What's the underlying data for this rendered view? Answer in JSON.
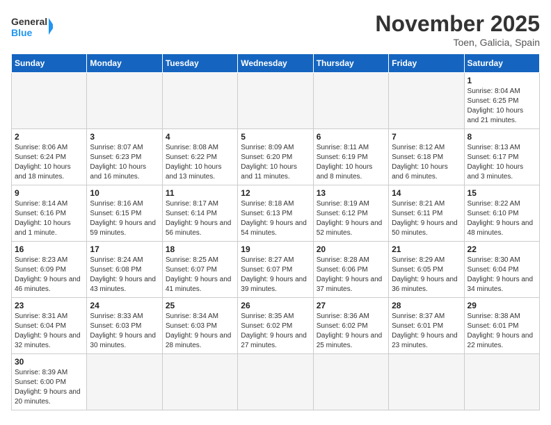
{
  "header": {
    "logo_general": "General",
    "logo_blue": "Blue",
    "month_title": "November 2025",
    "location": "Toen, Galicia, Spain"
  },
  "weekdays": [
    "Sunday",
    "Monday",
    "Tuesday",
    "Wednesday",
    "Thursday",
    "Friday",
    "Saturday"
  ],
  "weeks": [
    [
      {
        "day": "",
        "info": "",
        "empty": true
      },
      {
        "day": "",
        "info": "",
        "empty": true
      },
      {
        "day": "",
        "info": "",
        "empty": true
      },
      {
        "day": "",
        "info": "",
        "empty": true
      },
      {
        "day": "",
        "info": "",
        "empty": true
      },
      {
        "day": "",
        "info": "",
        "empty": true
      },
      {
        "day": "1",
        "info": "Sunrise: 8:04 AM\nSunset: 6:25 PM\nDaylight: 10 hours\nand 21 minutes."
      }
    ],
    [
      {
        "day": "2",
        "info": "Sunrise: 8:06 AM\nSunset: 6:24 PM\nDaylight: 10 hours\nand 18 minutes."
      },
      {
        "day": "3",
        "info": "Sunrise: 8:07 AM\nSunset: 6:23 PM\nDaylight: 10 hours\nand 16 minutes."
      },
      {
        "day": "4",
        "info": "Sunrise: 8:08 AM\nSunset: 6:22 PM\nDaylight: 10 hours\nand 13 minutes."
      },
      {
        "day": "5",
        "info": "Sunrise: 8:09 AM\nSunset: 6:20 PM\nDaylight: 10 hours\nand 11 minutes."
      },
      {
        "day": "6",
        "info": "Sunrise: 8:11 AM\nSunset: 6:19 PM\nDaylight: 10 hours\nand 8 minutes."
      },
      {
        "day": "7",
        "info": "Sunrise: 8:12 AM\nSunset: 6:18 PM\nDaylight: 10 hours\nand 6 minutes."
      },
      {
        "day": "8",
        "info": "Sunrise: 8:13 AM\nSunset: 6:17 PM\nDaylight: 10 hours\nand 3 minutes."
      }
    ],
    [
      {
        "day": "9",
        "info": "Sunrise: 8:14 AM\nSunset: 6:16 PM\nDaylight: 10 hours\nand 1 minute."
      },
      {
        "day": "10",
        "info": "Sunrise: 8:16 AM\nSunset: 6:15 PM\nDaylight: 9 hours\nand 59 minutes."
      },
      {
        "day": "11",
        "info": "Sunrise: 8:17 AM\nSunset: 6:14 PM\nDaylight: 9 hours\nand 56 minutes."
      },
      {
        "day": "12",
        "info": "Sunrise: 8:18 AM\nSunset: 6:13 PM\nDaylight: 9 hours\nand 54 minutes."
      },
      {
        "day": "13",
        "info": "Sunrise: 8:19 AM\nSunset: 6:12 PM\nDaylight: 9 hours\nand 52 minutes."
      },
      {
        "day": "14",
        "info": "Sunrise: 8:21 AM\nSunset: 6:11 PM\nDaylight: 9 hours\nand 50 minutes."
      },
      {
        "day": "15",
        "info": "Sunrise: 8:22 AM\nSunset: 6:10 PM\nDaylight: 9 hours\nand 48 minutes."
      }
    ],
    [
      {
        "day": "16",
        "info": "Sunrise: 8:23 AM\nSunset: 6:09 PM\nDaylight: 9 hours\nand 46 minutes."
      },
      {
        "day": "17",
        "info": "Sunrise: 8:24 AM\nSunset: 6:08 PM\nDaylight: 9 hours\nand 43 minutes."
      },
      {
        "day": "18",
        "info": "Sunrise: 8:25 AM\nSunset: 6:07 PM\nDaylight: 9 hours\nand 41 minutes."
      },
      {
        "day": "19",
        "info": "Sunrise: 8:27 AM\nSunset: 6:07 PM\nDaylight: 9 hours\nand 39 minutes."
      },
      {
        "day": "20",
        "info": "Sunrise: 8:28 AM\nSunset: 6:06 PM\nDaylight: 9 hours\nand 37 minutes."
      },
      {
        "day": "21",
        "info": "Sunrise: 8:29 AM\nSunset: 6:05 PM\nDaylight: 9 hours\nand 36 minutes."
      },
      {
        "day": "22",
        "info": "Sunrise: 8:30 AM\nSunset: 6:04 PM\nDaylight: 9 hours\nand 34 minutes."
      }
    ],
    [
      {
        "day": "23",
        "info": "Sunrise: 8:31 AM\nSunset: 6:04 PM\nDaylight: 9 hours\nand 32 minutes."
      },
      {
        "day": "24",
        "info": "Sunrise: 8:33 AM\nSunset: 6:03 PM\nDaylight: 9 hours\nand 30 minutes."
      },
      {
        "day": "25",
        "info": "Sunrise: 8:34 AM\nSunset: 6:03 PM\nDaylight: 9 hours\nand 28 minutes."
      },
      {
        "day": "26",
        "info": "Sunrise: 8:35 AM\nSunset: 6:02 PM\nDaylight: 9 hours\nand 27 minutes."
      },
      {
        "day": "27",
        "info": "Sunrise: 8:36 AM\nSunset: 6:02 PM\nDaylight: 9 hours\nand 25 minutes."
      },
      {
        "day": "28",
        "info": "Sunrise: 8:37 AM\nSunset: 6:01 PM\nDaylight: 9 hours\nand 23 minutes."
      },
      {
        "day": "29",
        "info": "Sunrise: 8:38 AM\nSunset: 6:01 PM\nDaylight: 9 hours\nand 22 minutes."
      }
    ],
    [
      {
        "day": "30",
        "info": "Sunrise: 8:39 AM\nSunset: 6:00 PM\nDaylight: 9 hours\nand 20 minutes."
      },
      {
        "day": "",
        "info": "",
        "empty": true
      },
      {
        "day": "",
        "info": "",
        "empty": true
      },
      {
        "day": "",
        "info": "",
        "empty": true
      },
      {
        "day": "",
        "info": "",
        "empty": true
      },
      {
        "day": "",
        "info": "",
        "empty": true
      },
      {
        "day": "",
        "info": "",
        "empty": true
      }
    ]
  ]
}
